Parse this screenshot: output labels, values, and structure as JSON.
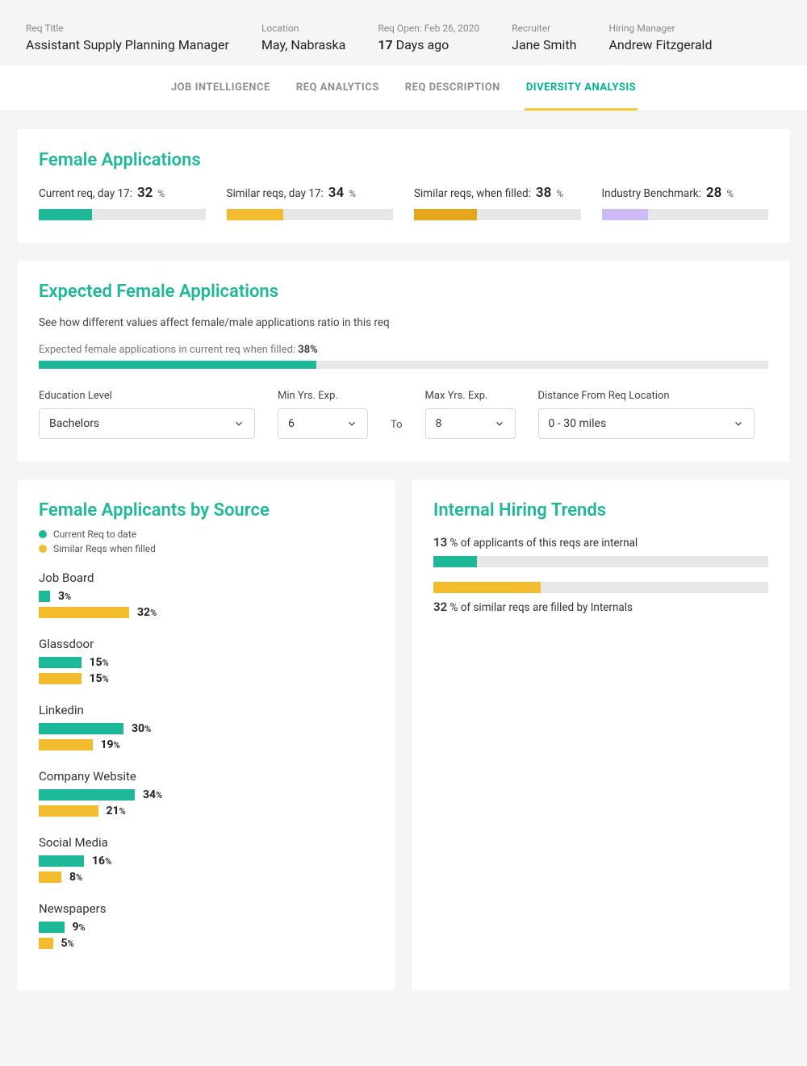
{
  "header": {
    "req_title_label": "Req Title",
    "req_title_value": "Assistant Supply Planning Manager",
    "location_label": "Location",
    "location_value": "May, Nabraska",
    "req_open_label": "Req Open: Feb 26, 2020",
    "req_open_value_strong": "17",
    "req_open_value_suffix": " Days ago",
    "recruiter_label": "Recruiter",
    "recruiter_value": "Jane Smith",
    "hiring_manager_label": "Hiring Manager",
    "hiring_manager_value": "Andrew Fitzgerald"
  },
  "tabs": {
    "items": [
      {
        "label": "JOB INTELLIGENCE",
        "active": false
      },
      {
        "label": "REQ ANALYTICS",
        "active": false
      },
      {
        "label": "REQ DESCRIPTION",
        "active": false
      },
      {
        "label": "DIVERSITY ANALYSIS",
        "active": true
      }
    ]
  },
  "female_applications": {
    "title": "Female Applications",
    "items": [
      {
        "label": "Current req, day 17:",
        "value": 32,
        "color": "#1db898"
      },
      {
        "label": "Similar reqs, day 17:",
        "value": 34,
        "color": "#f3bc2e"
      },
      {
        "label": "Similar reqs, when filled:",
        "value": 38,
        "color": "#e6a61c"
      },
      {
        "label": "Industry Benchmark:",
        "value": 28,
        "color": "#cdbbf7"
      }
    ]
  },
  "expected": {
    "title": "Expected Female Applications",
    "subtitle": "See how different values affect female/male applications ratio in this req",
    "line_prefix": "Expected female applications in current req when filled: ",
    "line_value": "38%",
    "bar_value": 38,
    "controls": {
      "education_label": "Education Level",
      "education_value": "Bachelors",
      "min_label": "Min Yrs. Exp.",
      "min_value": "6",
      "to_label": "To",
      "max_label": "Max Yrs. Exp.",
      "max_value": "8",
      "distance_label": "Distance From Req Location",
      "distance_value": "0 - 30 miles"
    }
  },
  "by_source": {
    "title": "Female Applicants by Source",
    "legend": [
      {
        "label": "Current Req to date",
        "color": "#1db898"
      },
      {
        "label": "Similar Reqs when filled",
        "color": "#f3bc2e"
      }
    ],
    "sources": [
      {
        "name": "Job Board",
        "current": 3,
        "similar": 32
      },
      {
        "name": "Glassdoor",
        "current": 15,
        "similar": 15
      },
      {
        "name": "Linkedin",
        "current": 30,
        "similar": 19
      },
      {
        "name": "Company Website",
        "current": 34,
        "similar": 21
      },
      {
        "name": "Social Media",
        "current": 16,
        "similar": 8
      },
      {
        "name": "Newspapers",
        "current": 9,
        "similar": 5
      }
    ],
    "bar_scale": 3.5
  },
  "internal": {
    "title": "Internal Hiring Trends",
    "row1": {
      "value": 13,
      "suffix": " % of applicants of this reqs are internal",
      "color": "#1db898"
    },
    "row2": {
      "value": 32,
      "suffix": " % of similar reqs are filled by Internals",
      "color": "#f3bc2e"
    }
  }
}
